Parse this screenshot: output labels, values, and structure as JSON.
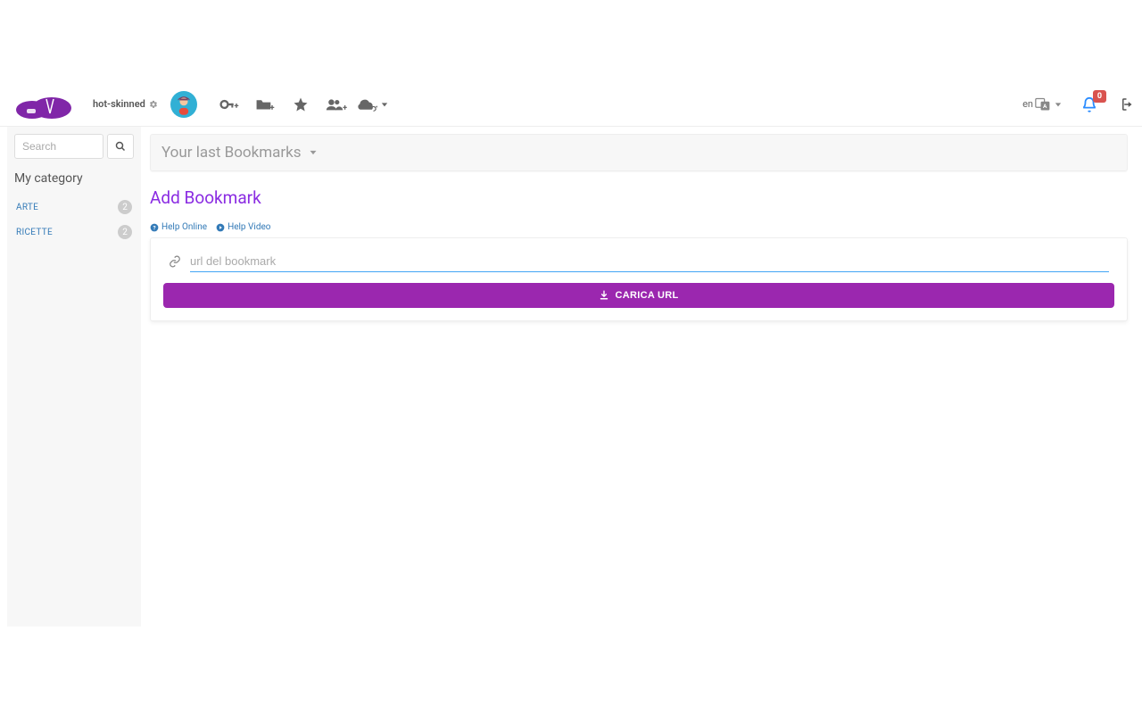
{
  "header": {
    "username": "hot-skinned",
    "lang": "en",
    "notifications": "0"
  },
  "sidebar": {
    "search_placeholder": "Search",
    "title": "My category",
    "items": [
      {
        "label": "ARTE",
        "count": "2"
      },
      {
        "label": "RICETTE",
        "count": "2"
      }
    ]
  },
  "main": {
    "panel_title": "Your last Bookmarks",
    "heading": "Add Bookmark",
    "help_online": "Help Online",
    "help_video": "Help Video",
    "url_placeholder": "url del bookmark",
    "load_btn": "CARICA URL"
  }
}
